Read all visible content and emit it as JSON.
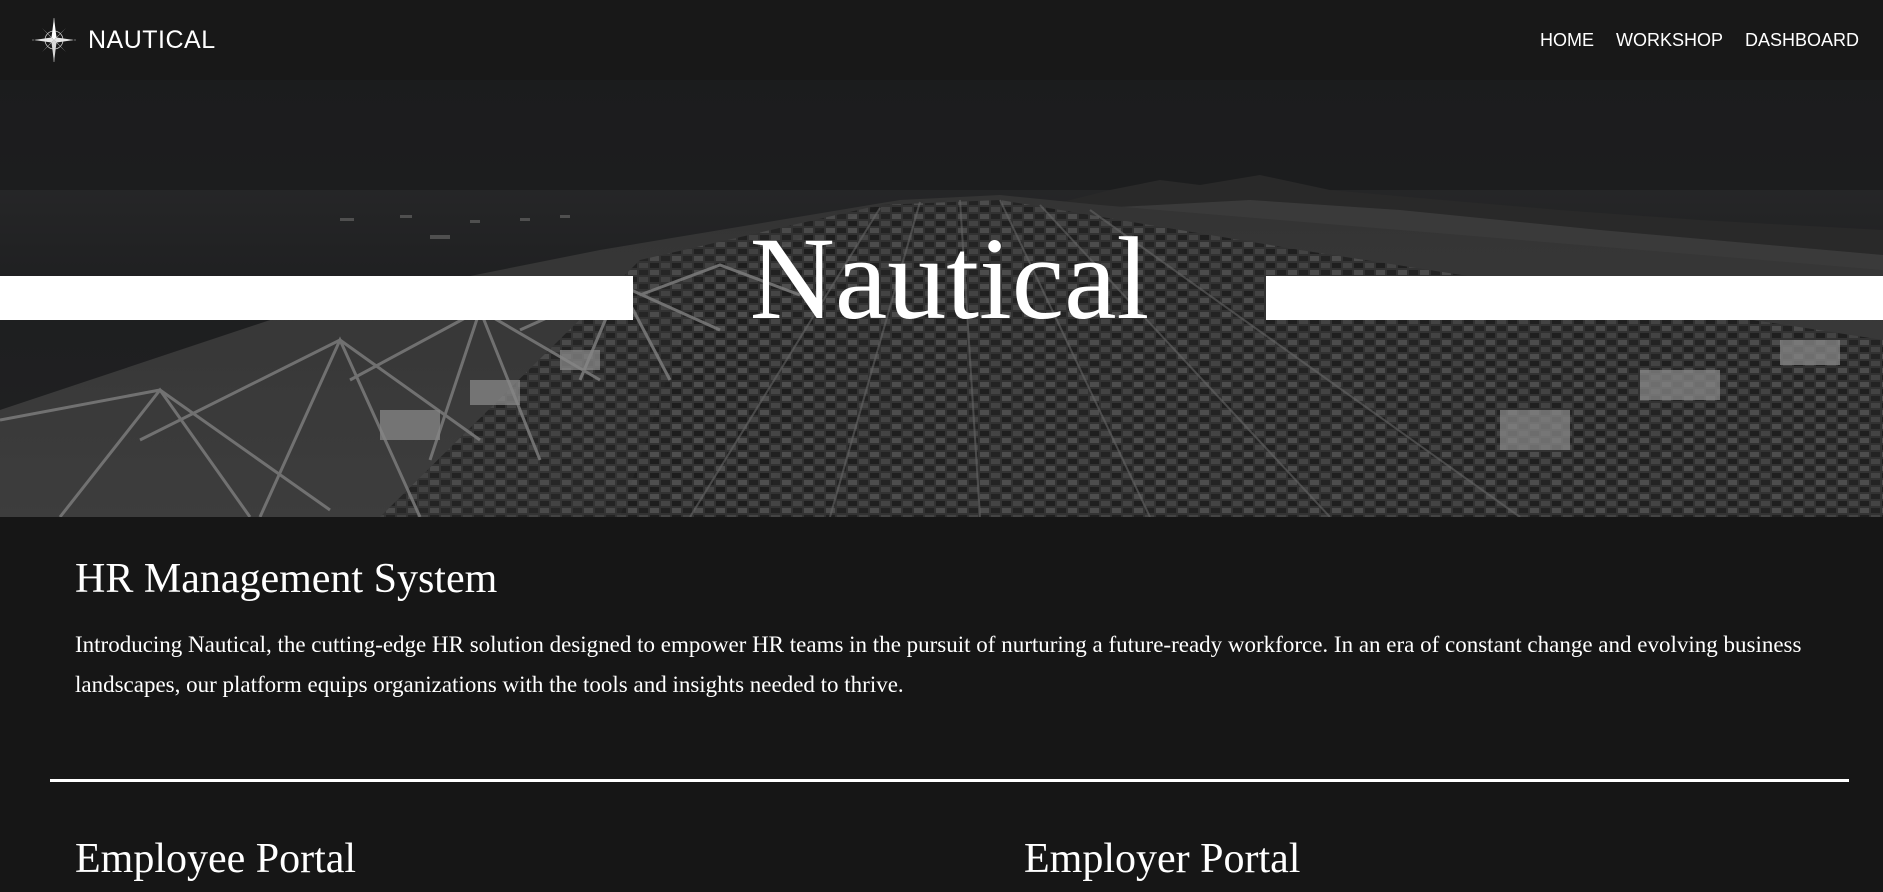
{
  "navbar": {
    "brand_text": "NAUTICAL",
    "logo_icon": "compass-rose-icon",
    "links": [
      {
        "label": "HOME"
      },
      {
        "label": "WORKSHOP"
      },
      {
        "label": "DASHBOARD"
      }
    ]
  },
  "hero": {
    "title": "Nautical",
    "background": "aerial-container-port-photo"
  },
  "intro": {
    "title": "HR Management System",
    "text": "Introducing Nautical, the cutting-edge HR solution designed to empower HR teams in the pursuit of nurturing a future-ready workforce. In an era of constant change and evolving business landscapes, our platform equips organizations with the tools and insights needed to thrive."
  },
  "portals": {
    "employee": {
      "title": "Employee Portal"
    },
    "employer": {
      "title": "Employer Portal"
    }
  },
  "colors": {
    "page_background": "#161616",
    "navbar_background": "#181818",
    "text": "#ffffff",
    "accent": "#ffffff"
  }
}
